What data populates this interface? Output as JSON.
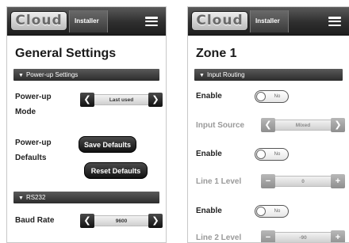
{
  "left": {
    "logo": "Cloud",
    "installer_label": "Installer",
    "title": "General Settings",
    "sections": {
      "power_up": "Power-up Settings",
      "rs232": "RS232"
    },
    "power_up_mode": {
      "label_line1": "Power-up",
      "label_line2": "Mode",
      "value": "Last used"
    },
    "power_up_defaults": {
      "label_line1": "Power-up",
      "label_line2": "Defaults",
      "save_button": "Save Defaults",
      "reset_button": "Reset Defaults"
    },
    "baud_rate": {
      "label": "Baud Rate",
      "value": "9600"
    }
  },
  "right": {
    "logo": "Cloud",
    "installer_label": "Installer",
    "title": "Zone 1",
    "section": "Input Routing",
    "rows": [
      {
        "label": "Enable",
        "toggle": "No"
      },
      {
        "label": "Input Source",
        "value": "Mixed"
      },
      {
        "label": "Enable",
        "toggle": "No"
      },
      {
        "label": "Line 1 Level",
        "value": "0"
      },
      {
        "label": "Enable",
        "toggle": "No"
      },
      {
        "label": "Line 2 Level",
        "value": "-90"
      }
    ]
  },
  "icons": {
    "menu": "hamburger-icon",
    "section_chevron": "chevron-down-icon",
    "prev": "chevron-left-icon",
    "next": "chevron-right-icon",
    "minus": "minus-icon",
    "plus": "plus-icon"
  },
  "colors": {
    "header_dark": "#2e2e2e",
    "button_dark": "#111111",
    "muted_text": "#9a9a9a"
  }
}
